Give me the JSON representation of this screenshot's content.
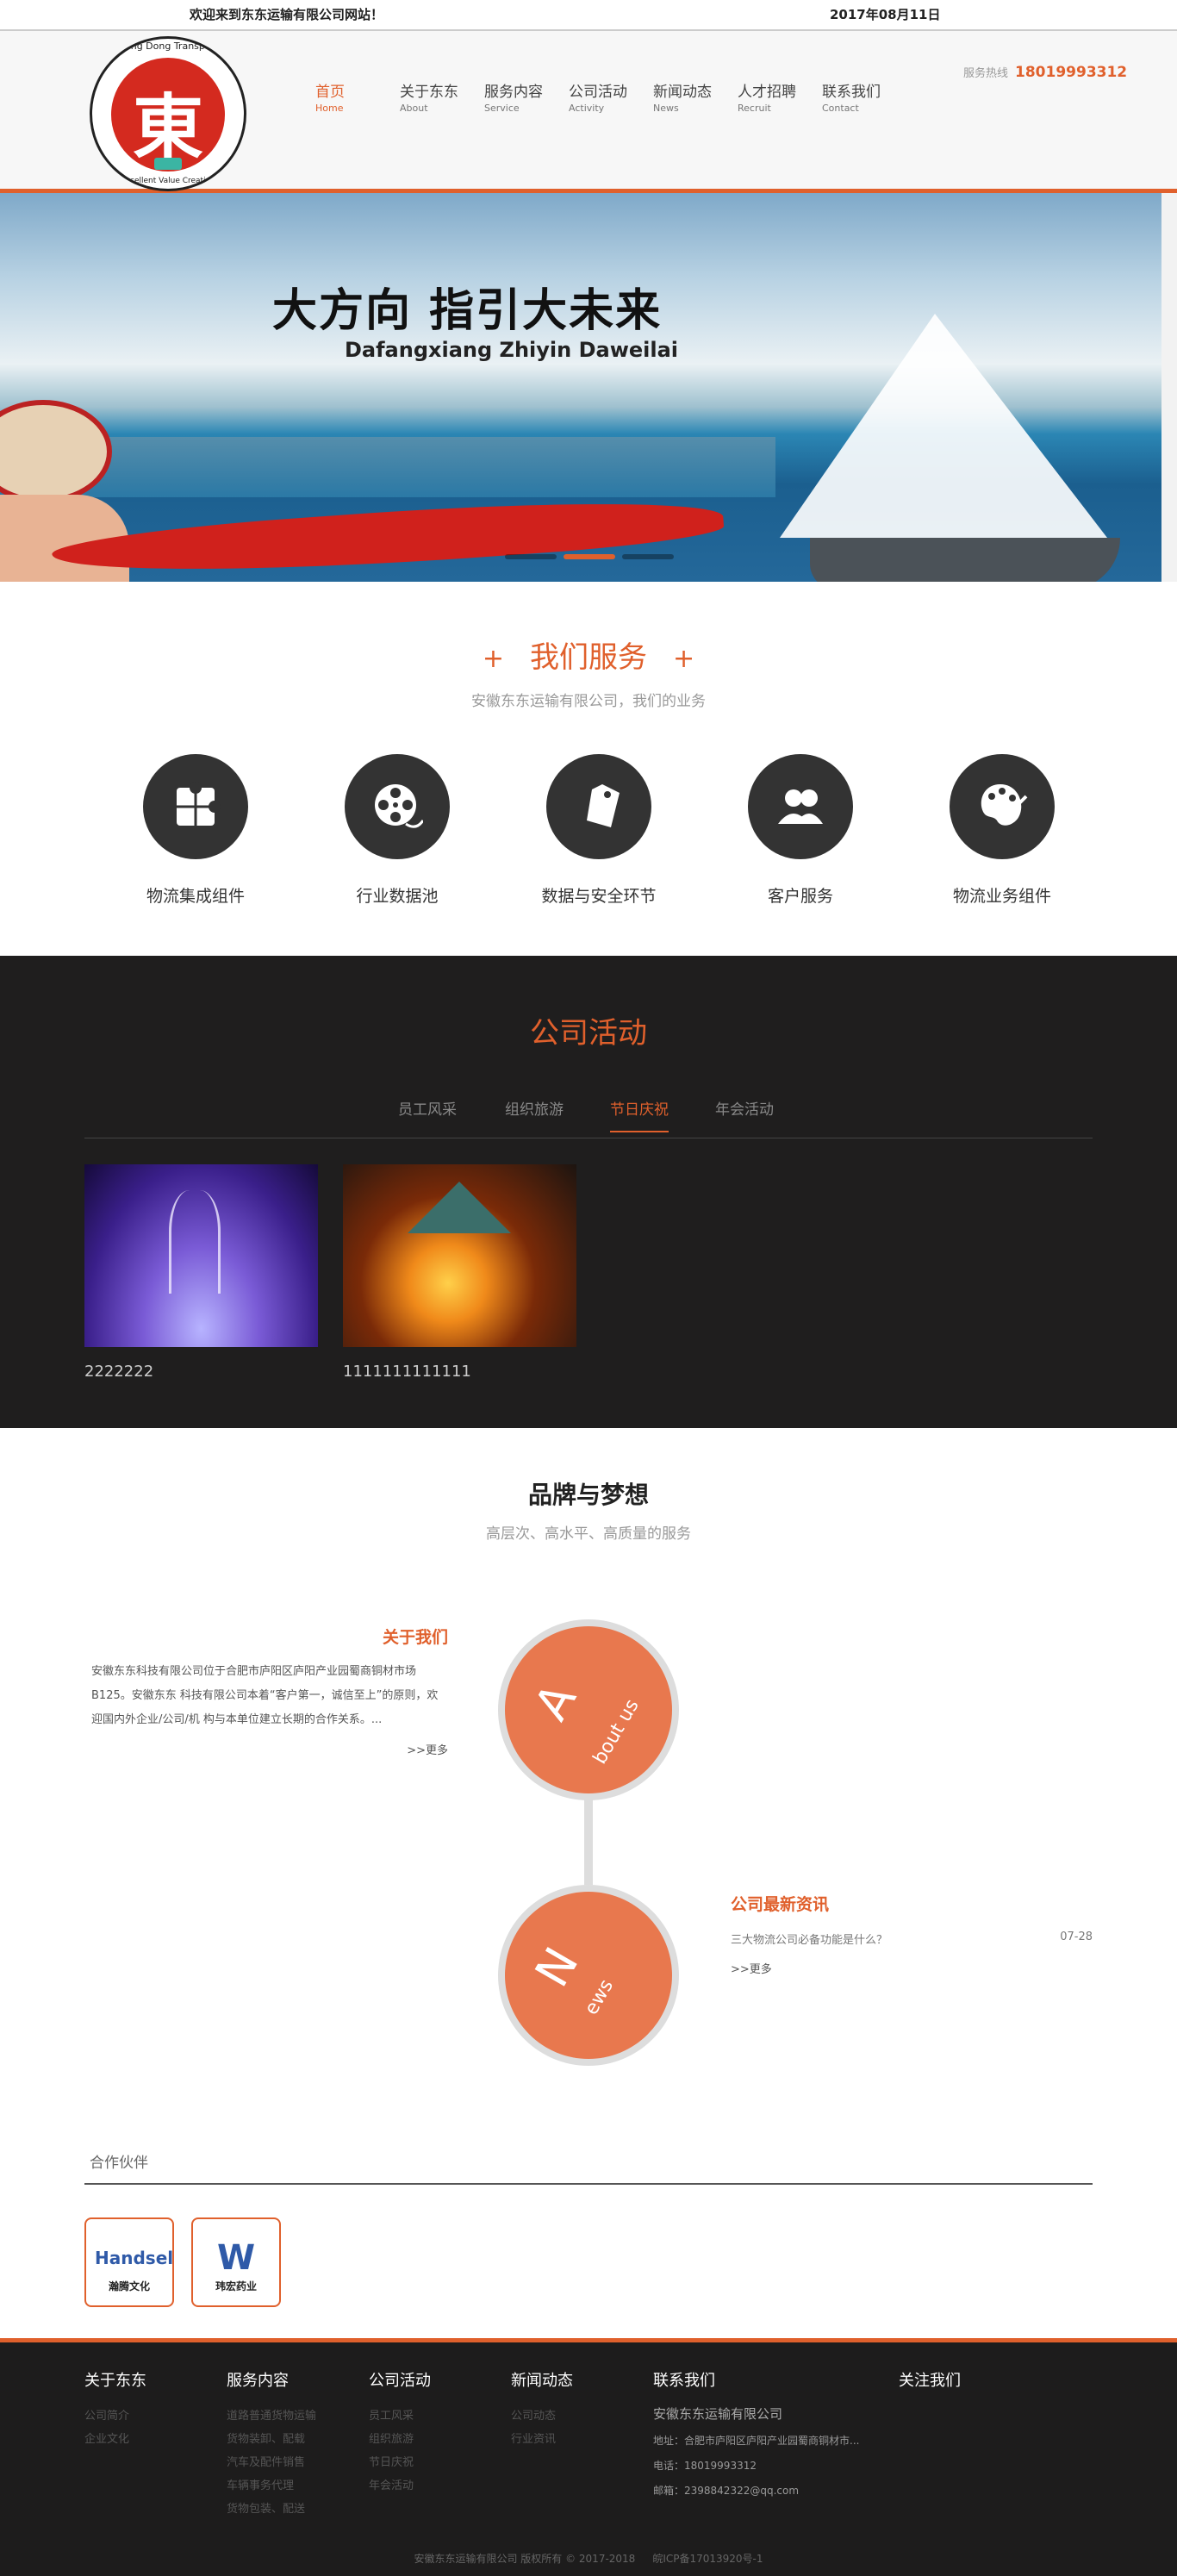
{
  "topbar": {
    "welcome": "欢迎来到东东运输有限公司网站！",
    "date": "2017年08月11日"
  },
  "logo": {
    "arc_top": "Dong Dong Transport",
    "glyph": "東",
    "arc_bottom": "Excellent Value Creation"
  },
  "nav": [
    {
      "cn": "首页",
      "en": "Home",
      "active": true
    },
    {
      "cn": "关于东东",
      "en": "About"
    },
    {
      "cn": "服务内容",
      "en": "Service"
    },
    {
      "cn": "公司活动",
      "en": "Activity"
    },
    {
      "cn": "新闻动态",
      "en": "News"
    },
    {
      "cn": "人才招聘",
      "en": "Recruit"
    },
    {
      "cn": "联系我们",
      "en": "Contact"
    }
  ],
  "hotline": {
    "label": "服务热线",
    "number": "18019993312"
  },
  "banner": {
    "title": "大方向  指引大未来",
    "subtitle": "Dafangxiang Zhiyin Daweilai",
    "slides": 3,
    "active_slide": 2
  },
  "services": {
    "title": "我们服务",
    "plus": "+",
    "subtitle": "安徽东东运输有限公司，我们的业务",
    "items": [
      {
        "label": "物流集成组件",
        "icon": "puzzle-icon"
      },
      {
        "label": "行业数据池",
        "icon": "film-reel-icon"
      },
      {
        "label": "数据与安全环节",
        "icon": "tag-icon"
      },
      {
        "label": "客户服务",
        "icon": "users-icon"
      },
      {
        "label": "物流业务组件",
        "icon": "palette-icon"
      }
    ]
  },
  "activities": {
    "title": "公司活动",
    "tabs": [
      "员工风采",
      "组织旅游",
      "节日庆祝",
      "年会活动"
    ],
    "active_tab": 2,
    "cards": [
      {
        "caption": "2222222"
      },
      {
        "caption": "1111111111111"
      }
    ]
  },
  "brand": {
    "title": "品牌与梦想",
    "subtitle": "高层次、高水平、高质量的服务",
    "about": {
      "heading": "关于我们",
      "text": "安徽东东科技有限公司位于合肥市庐阳区庐阳产业园蜀商铜材市场B125。安徽东东 科技有限公司本着“客户第一，诚信至上”的原则，欢迎国内外企业/公司/机 构与本单位建立长期的合作关系。...",
      "more": ">>更多",
      "circle_big": "A",
      "circle_small": "bout us"
    },
    "news": {
      "heading": "公司最新资讯",
      "items": [
        {
          "title": "三大物流公司必备功能是什么？",
          "date": "07-28"
        }
      ],
      "more": ">>更多",
      "circle_big": "N",
      "circle_small": "ews"
    }
  },
  "partners": {
    "title": "合作伙伴",
    "items": [
      {
        "logo": "Handsel",
        "caption": "瀚腾文化"
      },
      {
        "logo": "W",
        "caption": "玮宏药业"
      }
    ]
  },
  "footer": {
    "columns": [
      {
        "title": "关于东东",
        "links": [
          "公司简介",
          "企业文化"
        ]
      },
      {
        "title": "服务内容",
        "links": [
          "道路普通货物运输",
          "货物装卸、配载",
          "汽车及配件销售",
          "车辆事务代理",
          "货物包装、配送"
        ]
      },
      {
        "title": "公司活动",
        "links": [
          "员工风采",
          "组织旅游",
          "节日庆祝",
          "年会活动"
        ]
      },
      {
        "title": "新闻动态",
        "links": [
          "公司动态",
          "行业资讯"
        ]
      }
    ],
    "contact": {
      "title": "联系我们",
      "company": "安徽东东运输有限公司",
      "address": "地址：合肥市庐阳区庐阳产业园蜀商铜材市...",
      "phone": "电话：18019993312",
      "email": "邮箱：2398842322@qq.com"
    },
    "follow": "关注我们",
    "copyright": "安徽东东运输有限公司 版权所有 © 2017-2018",
    "icp": "皖ICP备17013920号-1"
  },
  "colors": {
    "accent": "#e0602c",
    "dark": "#1f1e1e"
  }
}
